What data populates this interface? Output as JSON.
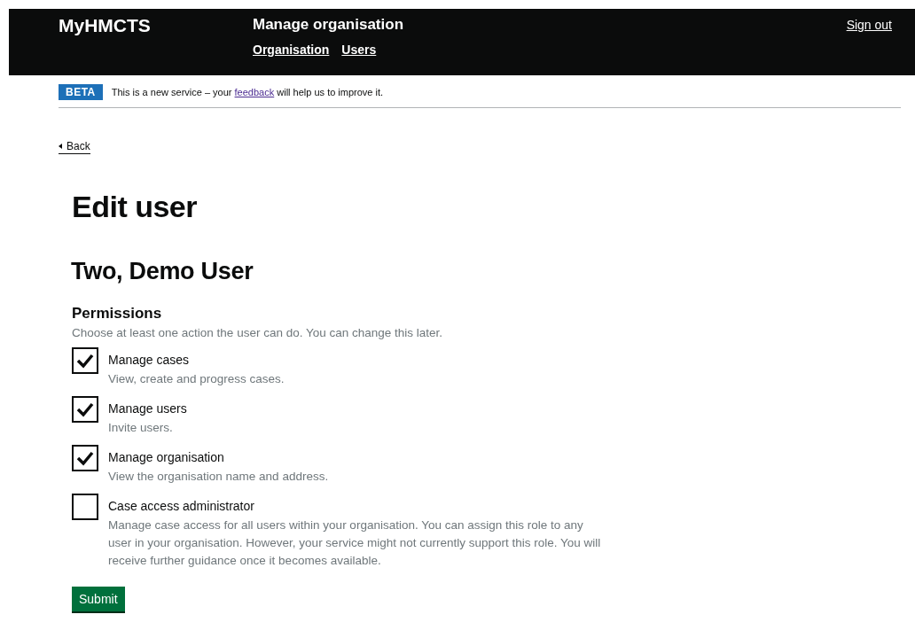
{
  "header": {
    "logo": "MyHMCTS",
    "service": "Manage organisation",
    "nav": [
      "Organisation",
      "Users"
    ],
    "sign_out": "Sign out"
  },
  "phase_banner": {
    "tag": "BETA",
    "text_before": "This is a new service – your",
    "link": "feedback",
    "text_after": "will help us to improve it."
  },
  "back_link": "Back",
  "title": "Edit user",
  "user_name": "Two, Demo User",
  "permissions": {
    "legend": "Permissions",
    "hint": "Choose at least one action the user can do. You can change this later.",
    "options": [
      {
        "label": "Manage cases",
        "hint": "View, create and progress cases.",
        "checked": true
      },
      {
        "label": "Manage users",
        "hint": "Invite users.",
        "checked": true
      },
      {
        "label": "Manage organisation",
        "hint": "View the organisation name and address.",
        "checked": true
      },
      {
        "label": "Case access administrator",
        "hint": "Manage case access for all users within your organisation. You can assign this role to any user in your organisation. However, your service might not currently support this role. You will receive further guidance once it becomes available.",
        "checked": false
      }
    ]
  },
  "submit": "Submit"
}
